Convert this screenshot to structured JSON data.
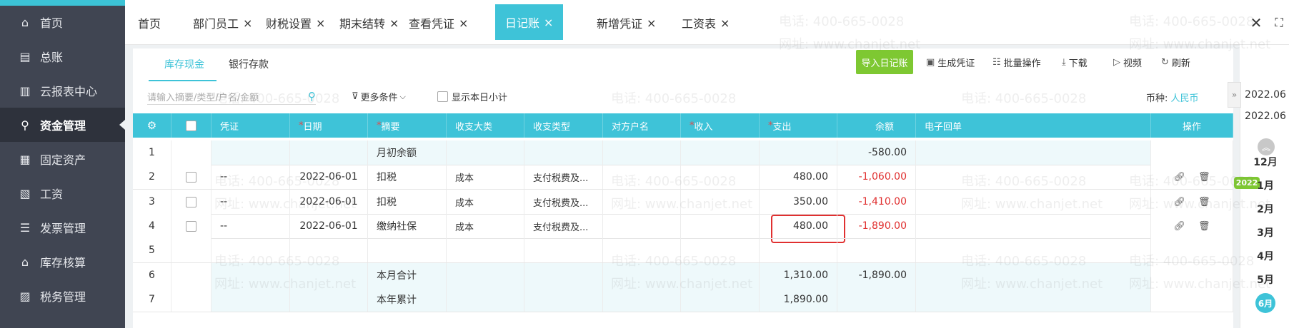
{
  "sidebar": {
    "items": [
      {
        "label": "首页",
        "icon": "home-icon"
      },
      {
        "label": "总账",
        "icon": "ledger-icon"
      },
      {
        "label": "云报表中心",
        "icon": "chart-icon"
      },
      {
        "label": "资金管理",
        "icon": "money-bag-icon"
      },
      {
        "label": "固定资产",
        "icon": "asset-icon"
      },
      {
        "label": "工资",
        "icon": "salary-icon"
      },
      {
        "label": "发票管理",
        "icon": "invoice-icon"
      },
      {
        "label": "库存核算",
        "icon": "warehouse-icon"
      },
      {
        "label": "税务管理",
        "icon": "tax-icon"
      }
    ],
    "active_index": 3
  },
  "tabs": [
    {
      "label": "首页",
      "closable": false
    },
    {
      "label": "部门员工",
      "closable": true
    },
    {
      "label": "财税设置",
      "closable": true
    },
    {
      "label": "期末结转",
      "closable": true
    },
    {
      "label": "查看凭证",
      "closable": true
    },
    {
      "label": "日记账",
      "closable": true,
      "active": true
    },
    {
      "label": "新增凭证",
      "closable": true
    },
    {
      "label": "工资表",
      "closable": true
    }
  ],
  "subtabs": {
    "cash": "库存现金",
    "bank": "银行存款"
  },
  "toolbar": {
    "import_label": "导入日记账",
    "generate_label": "生成凭证",
    "batch_label": "批量操作",
    "download_label": "下载",
    "video_label": "视频",
    "refresh_label": "刷新"
  },
  "filter": {
    "search_placeholder": "请输入摘要/类型/户名/金额",
    "more_conditions": "更多条件",
    "show_daily_subtotal": "显示本日小计",
    "currency_label": "币种:",
    "currency_value": "人民币"
  },
  "table": {
    "columns": [
      "凭证",
      "日期",
      "摘要",
      "收支大类",
      "收支类型",
      "对方户名",
      "收入",
      "支出",
      "余额",
      "电子回单",
      "操作"
    ],
    "required_columns": [
      "日期",
      "摘要",
      "收入",
      "支出"
    ],
    "rows": [
      {
        "no": "1",
        "voucher": "",
        "date": "",
        "summary": "月初余额",
        "category": "",
        "type": "",
        "party": "",
        "income": "",
        "expense": "",
        "balance": "-580.00",
        "has_checkbox": false,
        "has_actions": false
      },
      {
        "no": "2",
        "voucher": "--",
        "date": "2022-06-01",
        "summary": "扣税",
        "category": "成本",
        "type": "支付税费及...",
        "party": "",
        "income": "",
        "expense": "480.00",
        "balance": "-1,060.00",
        "has_checkbox": true,
        "has_actions": true
      },
      {
        "no": "3",
        "voucher": "--",
        "date": "2022-06-01",
        "summary": "扣税",
        "category": "成本",
        "type": "支付税费及...",
        "party": "",
        "income": "",
        "expense": "350.00",
        "balance": "-1,410.00",
        "has_checkbox": true,
        "has_actions": true
      },
      {
        "no": "4",
        "voucher": "--",
        "date": "2022-06-01",
        "summary": "缴纳社保",
        "category": "成本",
        "type": "支付税费及...",
        "party": "",
        "income": "",
        "expense": "480.00",
        "balance": "-1,890.00",
        "has_checkbox": true,
        "has_actions": true
      },
      {
        "no": "5",
        "voucher": "",
        "date": "",
        "summary": "",
        "category": "",
        "type": "",
        "party": "",
        "income": "",
        "expense": "",
        "balance": "",
        "has_checkbox": false,
        "has_actions": false
      },
      {
        "no": "6",
        "voucher": "",
        "date": "",
        "summary": "本月合计",
        "category": "",
        "type": "",
        "party": "",
        "income": "",
        "expense": "1,310.00",
        "balance": "-1,890.00",
        "has_checkbox": false,
        "has_actions": false
      },
      {
        "no": "7",
        "voucher": "",
        "date": "",
        "summary": "本年累计",
        "category": "",
        "type": "",
        "party": "",
        "income": "",
        "expense": "1,890.00",
        "balance": "",
        "has_checkbox": false,
        "has_actions": false
      }
    ]
  },
  "period_panel": {
    "from": "2022.06",
    "to": "2022.06",
    "year_badge": "2022",
    "months": [
      "12月",
      "1月",
      "2月",
      "3月",
      "4月",
      "5月",
      "6月"
    ],
    "selected_month": "6月"
  },
  "watermark": {
    "phone": "电话: 400-665-0028",
    "site": "网址: www.chanjet.net"
  },
  "colors": {
    "accent": "#3ec3d8",
    "import_button": "#7ec832",
    "negative": "#e03030",
    "sidebar": "#404552"
  }
}
